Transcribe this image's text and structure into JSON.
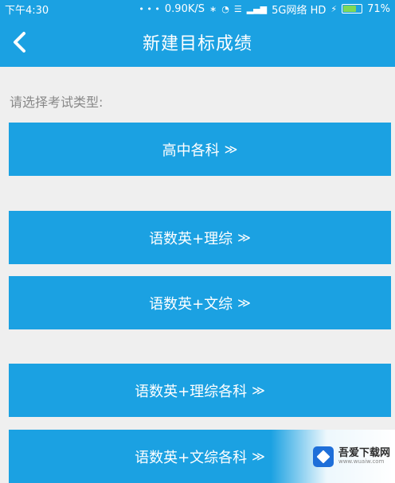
{
  "status_bar": {
    "time": "下午4:30",
    "dots": "• • •",
    "speed": "0.90K/S",
    "bluetooth": "∗",
    "alarm": "◔",
    "wifi": "☰",
    "signal": "▂▄▆",
    "network": "5G网络 HD",
    "charging": "⚡",
    "battery_text": "71%",
    "battery_level": 71,
    "battery_color": "#7ed957"
  },
  "header": {
    "back_icon": "back-chevron",
    "title": "新建目标成绩"
  },
  "prompt": "请选择考试类型:",
  "options": [
    {
      "label": "高中各科",
      "chevron": "≫"
    },
    {
      "label": "语数英+理综",
      "chevron": "≫"
    },
    {
      "label": "语数英+文综",
      "chevron": "≫"
    },
    {
      "label": "语数英+理综各科",
      "chevron": "≫"
    },
    {
      "label": "语数英+文综各科",
      "chevron": "≫"
    }
  ],
  "watermark": {
    "title": "吾爱下载网",
    "url": "www.wuaiw.com"
  },
  "colors": {
    "accent": "#1ba1e2",
    "background": "#efefef",
    "prompt_text": "#888888"
  }
}
